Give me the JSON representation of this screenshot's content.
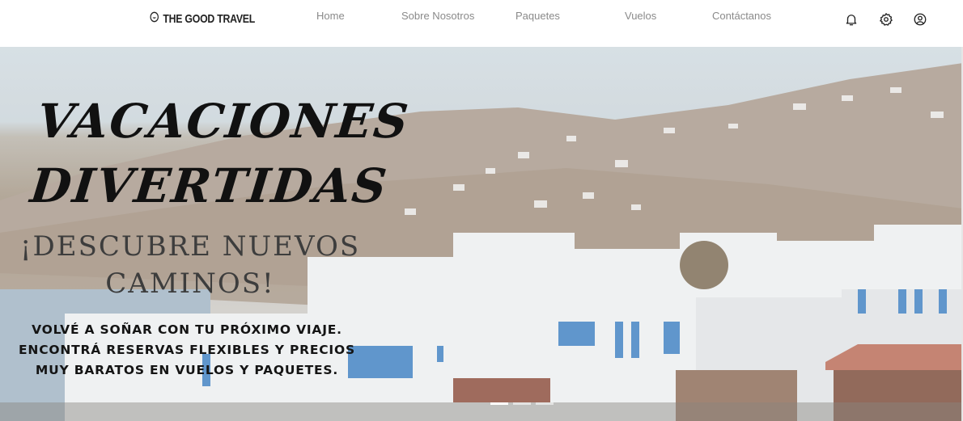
{
  "brand": {
    "name": "THE GOOD TRAVEL",
    "icon": "smile-logo-icon"
  },
  "nav": {
    "items": [
      "Home",
      "Sobre Nosotros",
      "Paquetes",
      "Vuelos",
      "Contáctanos"
    ]
  },
  "header_icons": [
    "bell-icon",
    "gear-icon",
    "user-circle-icon"
  ],
  "hero": {
    "title_line1": "VACACIONES",
    "title_line2": "DIVERTIDAS",
    "subtitle_line1": "¡DESCUBRE NUEVOS",
    "subtitle_line2": "CAMINOS!",
    "body_line1": "VOLVÉ A SOÑAR CON TU PRÓXIMO VIAJE.",
    "body_line2": "ENCONTRÁ RESERVAS FLEXIBLES Y PRECIOS",
    "body_line3": "MUY BARATOS EN VUELOS Y PAQUETES.",
    "carousel": {
      "slides": 3,
      "active": 1
    }
  },
  "colors": {
    "nav_text": "#8a8a8a",
    "title": "#111111",
    "accent_blue": "#3e7fc1"
  }
}
